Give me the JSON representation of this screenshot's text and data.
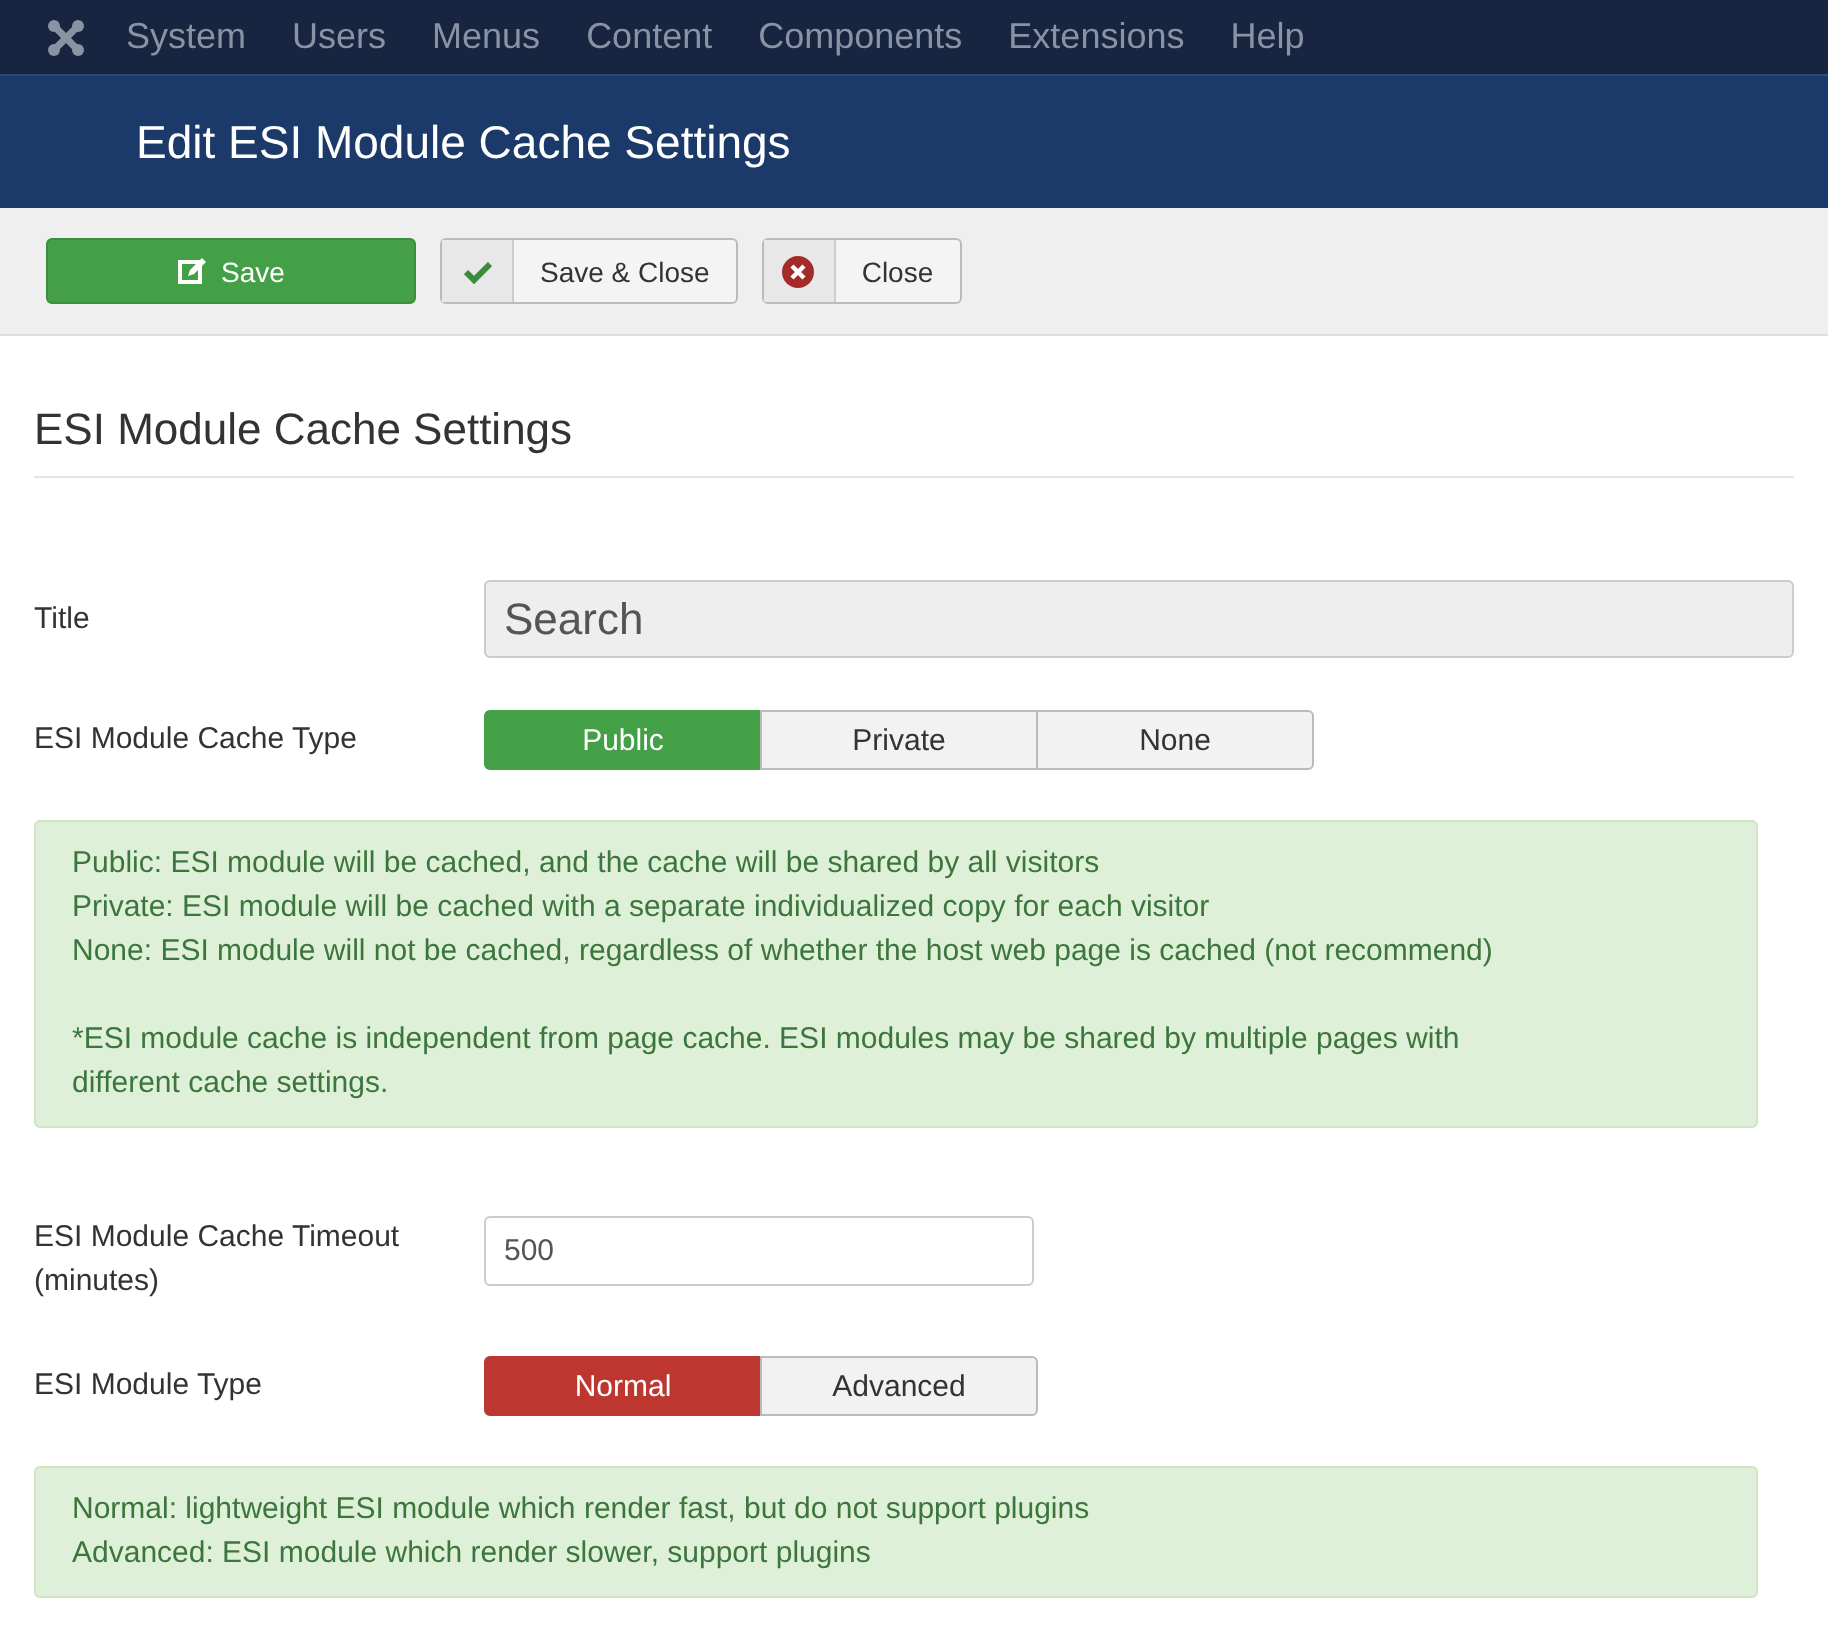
{
  "menu": [
    "System",
    "Users",
    "Menus",
    "Content",
    "Components",
    "Extensions",
    "Help"
  ],
  "page_title": "Edit ESI Module Cache Settings",
  "toolbar": [
    {
      "kind": "save",
      "label": "Save"
    },
    {
      "kind": "save-close",
      "label": "Save & Close"
    },
    {
      "kind": "close",
      "label": "Close"
    }
  ],
  "heading": "ESI Module Cache Settings",
  "fields": [
    {
      "kind": "text",
      "label": "Title",
      "value": "Search",
      "readonly": true
    },
    {
      "kind": "toggle",
      "label": "ESI Module Cache Type",
      "color": "#43a047",
      "options": [
        {
          "label": "Public",
          "selected": true
        },
        {
          "label": "Private",
          "selected": false
        },
        {
          "label": "None",
          "selected": false
        }
      ]
    },
    {
      "kind": "note",
      "paragraphs": [
        [
          "Public: ESI module will be cached, and the cache will be shared by all visitors",
          "Private: ESI module will be cached with a separate individualized copy for each visitor",
          "None: ESI module will not be cached, regardless of whether the host web page is cached (not recommend)"
        ],
        [
          "*ESI module cache is independent from page cache. ESI modules may be shared by multiple pages with",
          "different cache settings."
        ]
      ]
    },
    {
      "kind": "number",
      "label": "ESI Module Cache Timeout (minutes)",
      "value": "500",
      "readonly": false
    },
    {
      "kind": "toggle",
      "label": "ESI Module Type",
      "color": "#bd362f",
      "options": [
        {
          "label": "Normal",
          "selected": true
        },
        {
          "label": "Advanced",
          "selected": false
        }
      ]
    },
    {
      "kind": "note",
      "paragraphs": [
        [
          "Normal: lightweight ESI module which render fast, but do not support plugins",
          "Advanced: ESI module which render slower, support plugins"
        ]
      ]
    }
  ]
}
